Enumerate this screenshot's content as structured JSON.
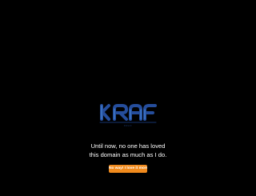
{
  "logo": {
    "wordmark": "KRAF",
    "color": "#254d9b",
    "accent": "#4a8fe0"
  },
  "message": {
    "line1": "Until now, no one has loved",
    "line2": "this domain as much as I do."
  },
  "cta": {
    "label": "No way! I love it more!",
    "color": "#f08a1d"
  }
}
